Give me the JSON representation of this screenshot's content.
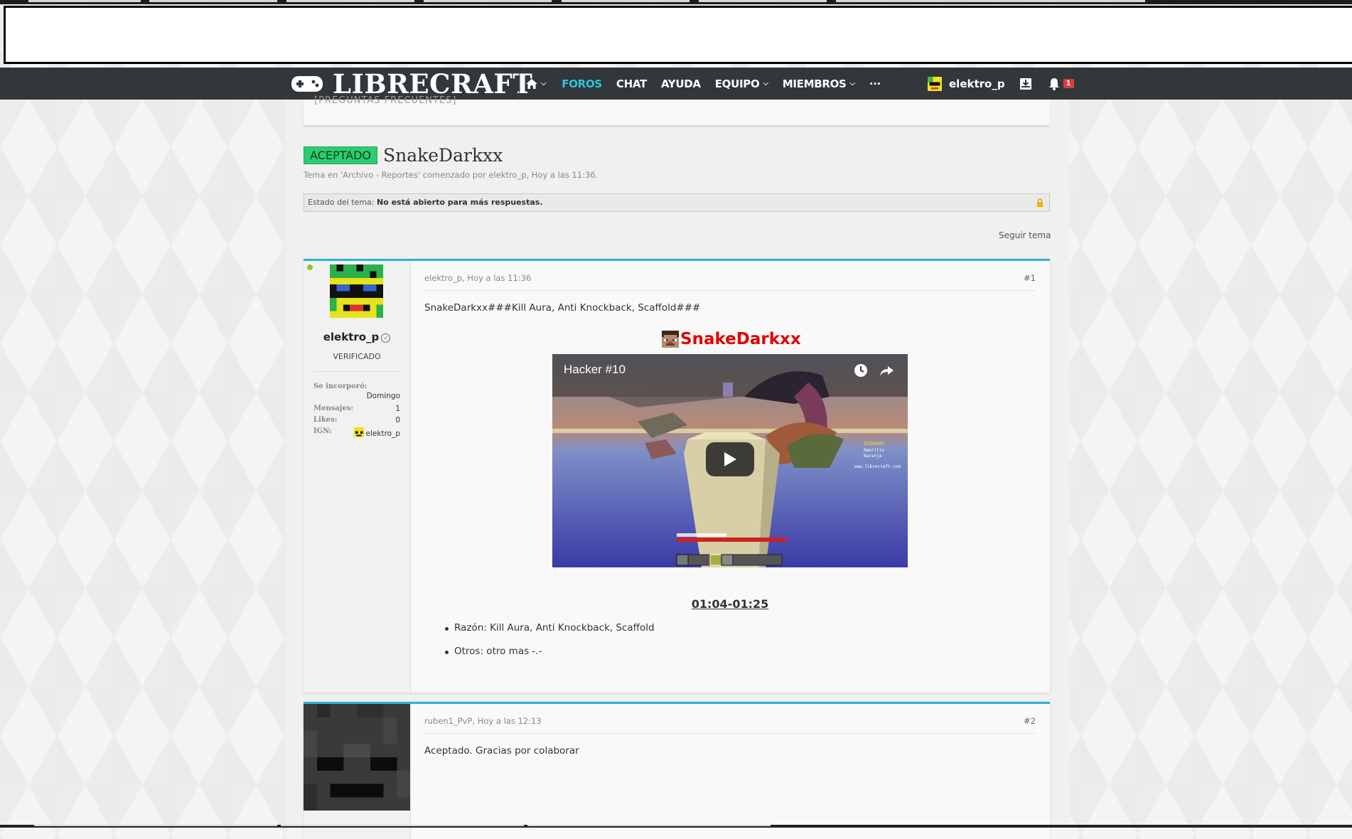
{
  "site": {
    "logo": "LIBRECRAFT"
  },
  "nav": {
    "items": [
      {
        "label": "FOROS",
        "active": true,
        "chevron": false
      },
      {
        "label": "CHAT",
        "active": false,
        "chevron": false
      },
      {
        "label": "AYUDA",
        "active": false,
        "chevron": false
      },
      {
        "label": "EQUIPO",
        "active": false,
        "chevron": true
      },
      {
        "label": "MIEMBROS",
        "active": false,
        "chevron": true
      },
      {
        "label": "···",
        "active": false,
        "chevron": false
      }
    ],
    "user_name": "elektro_p",
    "notifications_count": "1",
    "accent_color": "#2fc4dc",
    "bar_color": "#31373b"
  },
  "previous_box": {
    "cut_text": "[PREGUNTAS FRECUENTES]"
  },
  "thread": {
    "prefix": "ACEPTADO",
    "title": "SnakeDarkxx",
    "meta": "Tema en 'Archivo - Reportes' comenzado por elektro_p, Hoy a las 11:36.",
    "status_label": "Estado del tema:",
    "status_value": "No está abierto para más respuestas.",
    "follow_label": "Seguir tema"
  },
  "posts": [
    {
      "user": "elektro_p",
      "role": "VERIFICADO",
      "stats": {
        "joined_label": "Se incorporó:",
        "joined_value": "Domingo",
        "messages_label": "Mensajes:",
        "messages_value": "1",
        "likes_label": "Likes:",
        "likes_value": "0",
        "ign_label": "IGN:",
        "ign_value": "elektro_p"
      },
      "meta": "elektro_p, Hoy a las 11:36",
      "number": "#1",
      "text": "SnakeDarkxx###Kill Aura, Anti Knockback, Scaffold###",
      "hacker_name": "SnakeDarkxx",
      "video_title": "Hacker #10",
      "timestamp": "01:04-01:25",
      "bullets": [
        "Razón: Kill Aura, Anti Knockback, Scaffold",
        "Otros: otro mas -.-"
      ]
    },
    {
      "meta": "ruben1_PvP, Hoy a las 12:13",
      "number": "#2",
      "text": "Aceptado. Gracias por colaborar"
    }
  ]
}
